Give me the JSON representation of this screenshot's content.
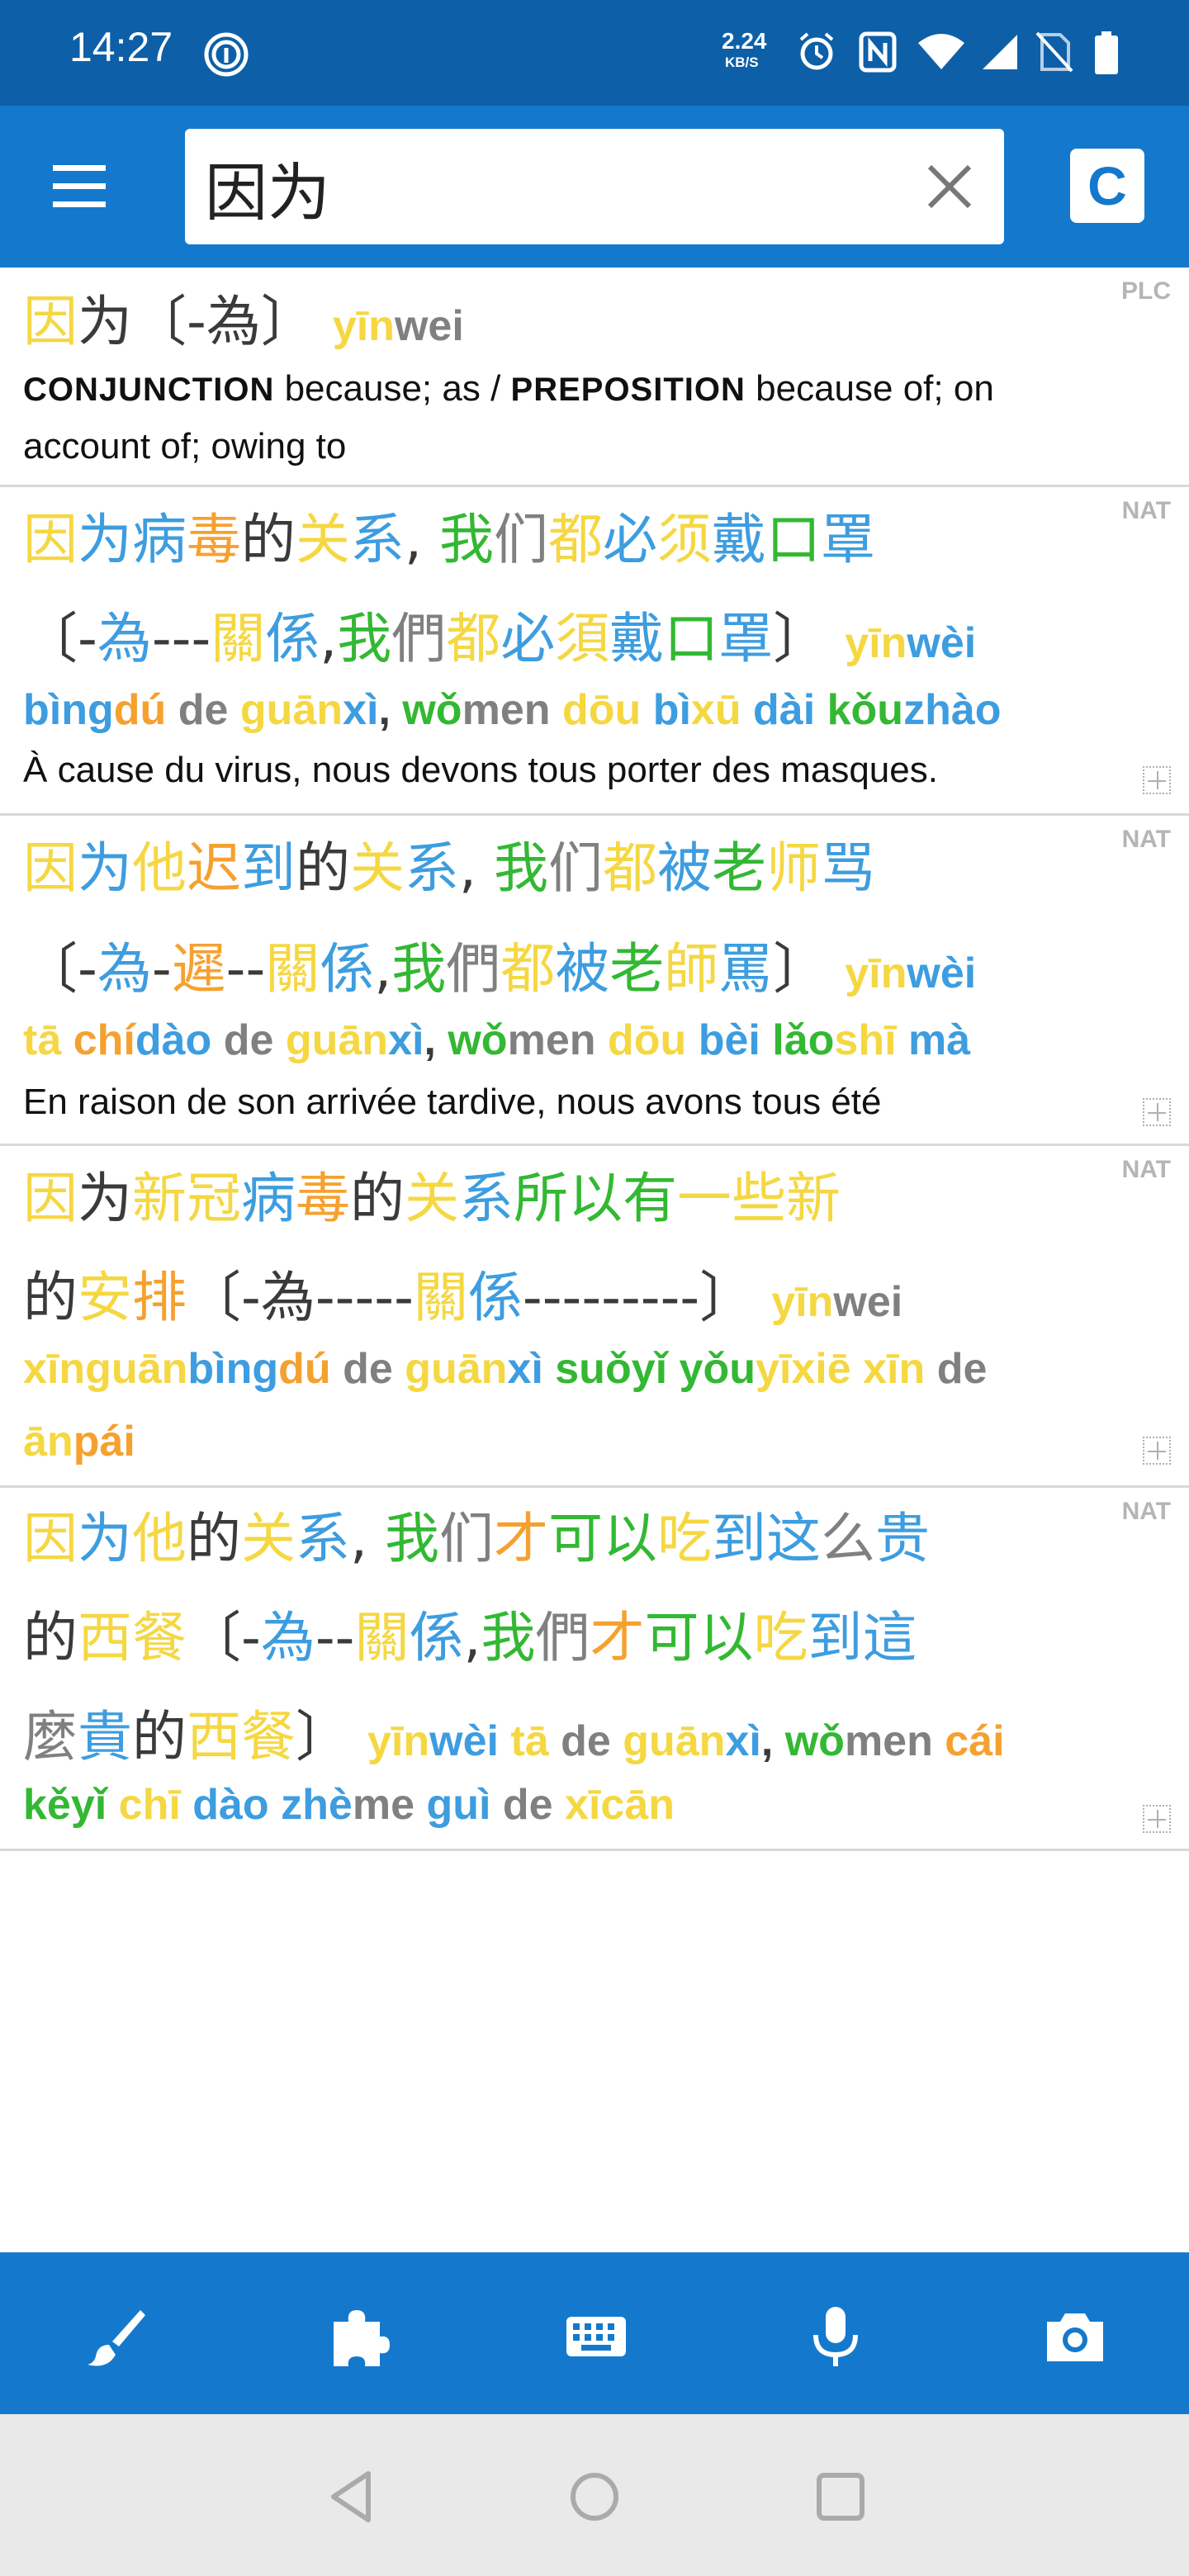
{
  "status_bar": {
    "time": "14:27",
    "net_speed_value": "2.24",
    "net_speed_unit": "KB/S",
    "icons": [
      "fingerprint-icon",
      "alarm-icon",
      "nfc-icon",
      "wifi-icon",
      "signal-icon",
      "no-sim-icon",
      "battery-icon"
    ]
  },
  "search": {
    "value": "因为",
    "clear_icon": "close-icon",
    "menu_icon": "menu-icon",
    "mode_label": "C"
  },
  "colors": {
    "primary": "#1479cc",
    "status_bar": "#0d5fa8",
    "tone1": "#f5d742",
    "tone2": "#f5a130",
    "tone3": "#33b833",
    "tone4": "#3d9de0",
    "tone_neutral": "#808080"
  },
  "entries": [
    {
      "tag": "PLC",
      "lines": [
        [
          [
            "因",
            "t1"
          ],
          [
            "为",
            "t0"
          ],
          [
            "〔-",
            "t0"
          ],
          [
            "為",
            "t0"
          ],
          [
            "〕",
            "t0"
          ],
          [
            " ",
            "t0"
          ],
          [
            "yīn",
            "t1",
            "py"
          ],
          [
            "wei",
            "t5",
            "py"
          ]
        ],
        [
          [
            "CONJUNCTION",
            "pos"
          ],
          [
            " because; as / ",
            "gloss"
          ],
          [
            " PREPOSITION",
            "pos"
          ],
          [
            " because of; on",
            "gloss"
          ]
        ],
        [
          [
            "account of; owing to",
            "gloss"
          ]
        ]
      ]
    },
    {
      "tag": "NAT",
      "lines": [
        [
          [
            "因",
            "t1"
          ],
          [
            "为",
            "t4"
          ],
          [
            "病",
            "t4"
          ],
          [
            "毒",
            "t2"
          ],
          [
            "的",
            "t0"
          ],
          [
            "关",
            "t1"
          ],
          [
            "系",
            "t4"
          ],
          [
            ", ",
            "t0"
          ],
          [
            "我",
            "t3"
          ],
          [
            "们",
            "t5"
          ],
          [
            "都",
            "t1"
          ],
          [
            "必",
            "t4"
          ],
          [
            "须",
            "t1"
          ],
          [
            "戴",
            "t4"
          ],
          [
            "口",
            "t3"
          ],
          [
            "罩",
            "t4"
          ]
        ],
        [
          [
            "〔-",
            "t0"
          ],
          [
            "為",
            "t4"
          ],
          [
            "---",
            "t0"
          ],
          [
            "關",
            "t1"
          ],
          [
            "係",
            "t4"
          ],
          [
            ",",
            "t0"
          ],
          [
            "我",
            "t3"
          ],
          [
            "們",
            "t5"
          ],
          [
            "都",
            "t1"
          ],
          [
            "必",
            "t4"
          ],
          [
            "須",
            "t1"
          ],
          [
            "戴",
            "t4"
          ],
          [
            "口",
            "t3"
          ],
          [
            "罩",
            "t4"
          ],
          [
            "〕",
            "t0"
          ],
          [
            " ",
            "t0"
          ],
          [
            "yīn",
            "t1",
            "py"
          ],
          [
            "wèi",
            "t4",
            "py"
          ]
        ],
        [
          [
            "bìng",
            "t4",
            "py"
          ],
          [
            "dú",
            "t2",
            "py"
          ],
          [
            " de ",
            "t5",
            "py"
          ],
          [
            "guān",
            "t1",
            "py"
          ],
          [
            "xì",
            "t4",
            "py"
          ],
          [
            ", ",
            "t0",
            "py"
          ],
          [
            "wǒ",
            "t3",
            "py"
          ],
          [
            "men",
            "t5",
            "py"
          ],
          [
            " dōu ",
            "t1",
            "py"
          ],
          [
            "bì",
            "t4",
            "py"
          ],
          [
            "xū",
            "t1",
            "py"
          ],
          [
            " dài ",
            "t4",
            "py"
          ],
          [
            "kǒu",
            "t3",
            "py"
          ],
          [
            "zhào",
            "t4",
            "py"
          ]
        ],
        [
          [
            "À cause du virus, nous devons tous porter des masques.",
            "gloss"
          ]
        ]
      ]
    },
    {
      "tag": "NAT",
      "lines": [
        [
          [
            "因",
            "t1"
          ],
          [
            "为",
            "t4"
          ],
          [
            "他",
            "t1"
          ],
          [
            "迟",
            "t2"
          ],
          [
            "到",
            "t4"
          ],
          [
            "的",
            "t0"
          ],
          [
            "关",
            "t1"
          ],
          [
            "系",
            "t4"
          ],
          [
            ", ",
            "t0"
          ],
          [
            "我",
            "t3"
          ],
          [
            "们",
            "t5"
          ],
          [
            "都",
            "t1"
          ],
          [
            "被",
            "t4"
          ],
          [
            "老",
            "t3"
          ],
          [
            "师",
            "t1"
          ],
          [
            "骂",
            "t4"
          ]
        ],
        [
          [
            "〔-",
            "t0"
          ],
          [
            "為",
            "t4"
          ],
          [
            "-",
            "t0"
          ],
          [
            "遲",
            "t2"
          ],
          [
            "--",
            "t0"
          ],
          [
            "關",
            "t1"
          ],
          [
            "係",
            "t4"
          ],
          [
            ",",
            "t0"
          ],
          [
            "我",
            "t3"
          ],
          [
            "們",
            "t5"
          ],
          [
            "都",
            "t1"
          ],
          [
            "被",
            "t4"
          ],
          [
            "老",
            "t3"
          ],
          [
            "師",
            "t1"
          ],
          [
            "罵",
            "t4"
          ],
          [
            "〕",
            "t0"
          ],
          [
            " ",
            "t0"
          ],
          [
            "yīn",
            "t1",
            "py"
          ],
          [
            "wèi",
            "t4",
            "py"
          ]
        ],
        [
          [
            "tā ",
            "t1",
            "py"
          ],
          [
            "chí",
            "t2",
            "py"
          ],
          [
            "dào",
            "t4",
            "py"
          ],
          [
            " de ",
            "t5",
            "py"
          ],
          [
            "guān",
            "t1",
            "py"
          ],
          [
            "xì",
            "t4",
            "py"
          ],
          [
            ", ",
            "t0",
            "py"
          ],
          [
            "wǒ",
            "t3",
            "py"
          ],
          [
            "men",
            "t5",
            "py"
          ],
          [
            " dōu ",
            "t1",
            "py"
          ],
          [
            "bèi ",
            "t4",
            "py"
          ],
          [
            "lǎo",
            "t3",
            "py"
          ],
          [
            "shī",
            "t1",
            "py"
          ],
          [
            " mà",
            "t4",
            "py"
          ]
        ],
        [
          [
            "En raison de son arrivée tardive, nous avons tous été",
            "gloss"
          ]
        ]
      ]
    },
    {
      "tag": "NAT",
      "lines": [
        [
          [
            "因",
            "t1"
          ],
          [
            "为",
            "t0"
          ],
          [
            "新",
            "t1"
          ],
          [
            "冠",
            "t1"
          ],
          [
            "病",
            "t4"
          ],
          [
            "毒",
            "t2"
          ],
          [
            "的",
            "t0"
          ],
          [
            "关",
            "t1"
          ],
          [
            "系",
            "t4"
          ],
          [
            "所",
            "t3"
          ],
          [
            "以",
            "t3"
          ],
          [
            "有",
            "t3"
          ],
          [
            "一",
            "t1"
          ],
          [
            "些",
            "t1"
          ],
          [
            "新",
            "t1"
          ]
        ],
        [
          [
            "的",
            "t0"
          ],
          [
            "安",
            "t1"
          ],
          [
            "排",
            "t2"
          ],
          [
            "〔-",
            "t0"
          ],
          [
            "為",
            "t0"
          ],
          [
            "-----",
            "t0"
          ],
          [
            "關",
            "t1"
          ],
          [
            "係",
            "t4"
          ],
          [
            "---------",
            "t0"
          ],
          [
            "〕",
            "t0"
          ],
          [
            " ",
            "t0"
          ],
          [
            "yīn",
            "t1",
            "py"
          ],
          [
            "wei",
            "t5",
            "py"
          ]
        ],
        [
          [
            "xīn",
            "t1",
            "py"
          ],
          [
            "guān",
            "t1",
            "py"
          ],
          [
            "bìng",
            "t4",
            "py"
          ],
          [
            "dú",
            "t2",
            "py"
          ],
          [
            " de ",
            "t5",
            "py"
          ],
          [
            "guān",
            "t1",
            "py"
          ],
          [
            "xì",
            "t4",
            "py"
          ],
          [
            " suǒ",
            "t3",
            "py"
          ],
          [
            "yǐ ",
            "t3",
            "py"
          ],
          [
            "yǒu",
            "t3",
            "py"
          ],
          [
            "yī",
            "t1",
            "py"
          ],
          [
            "xiē",
            "t1",
            "py"
          ],
          [
            " xīn",
            "t1",
            "py"
          ],
          [
            " de",
            "t5",
            "py"
          ]
        ],
        [
          [
            "ān",
            "t1",
            "py"
          ],
          [
            "pái",
            "t2",
            "py"
          ]
        ]
      ]
    },
    {
      "tag": "NAT",
      "lines": [
        [
          [
            "因",
            "t1"
          ],
          [
            "为",
            "t4"
          ],
          [
            "他",
            "t1"
          ],
          [
            "的",
            "t0"
          ],
          [
            "关",
            "t1"
          ],
          [
            "系",
            "t4"
          ],
          [
            ", ",
            "t0"
          ],
          [
            "我",
            "t3"
          ],
          [
            "们",
            "t5"
          ],
          [
            "才",
            "t2"
          ],
          [
            "可",
            "t3"
          ],
          [
            "以",
            "t3"
          ],
          [
            "吃",
            "t1"
          ],
          [
            "到",
            "t4"
          ],
          [
            "这",
            "t4"
          ],
          [
            "么",
            "t5"
          ],
          [
            "贵",
            "t4"
          ]
        ],
        [
          [
            "的",
            "t0"
          ],
          [
            "西",
            "t1"
          ],
          [
            "餐",
            "t1"
          ],
          [
            "〔-",
            "t0"
          ],
          [
            "為",
            "t4"
          ],
          [
            "--",
            "t0"
          ],
          [
            "關",
            "t1"
          ],
          [
            "係",
            "t4"
          ],
          [
            ",",
            "t0"
          ],
          [
            "我",
            "t3"
          ],
          [
            "們",
            "t5"
          ],
          [
            "才",
            "t2"
          ],
          [
            "可",
            "t3"
          ],
          [
            "以",
            "t3"
          ],
          [
            "吃",
            "t1"
          ],
          [
            "到",
            "t4"
          ],
          [
            "這",
            "t4"
          ]
        ],
        [
          [
            "麼",
            "t5"
          ],
          [
            "貴",
            "t4"
          ],
          [
            "的",
            "t0"
          ],
          [
            "西",
            "t1"
          ],
          [
            "餐",
            "t1"
          ],
          [
            "〕",
            "t0"
          ],
          [
            " ",
            "t0"
          ],
          [
            "yīn",
            "t1",
            "py"
          ],
          [
            "wèi",
            "t4",
            "py"
          ],
          [
            " tā",
            "t1",
            "py"
          ],
          [
            " de ",
            "t5",
            "py"
          ],
          [
            "guān",
            "t1",
            "py"
          ],
          [
            "xì",
            "t4",
            "py"
          ],
          [
            ", ",
            "t0",
            "py"
          ],
          [
            "wǒ",
            "t3",
            "py"
          ],
          [
            "men",
            "t5",
            "py"
          ],
          [
            " cái",
            "t2",
            "py"
          ]
        ],
        [
          [
            "kě",
            "t3",
            "py"
          ],
          [
            "yǐ",
            "t3",
            "py"
          ],
          [
            " chī",
            "t1",
            "py"
          ],
          [
            " dào",
            "t4",
            "py"
          ],
          [
            " zhè",
            "t4",
            "py"
          ],
          [
            "me",
            "t5",
            "py"
          ],
          [
            " guì",
            "t4",
            "py"
          ],
          [
            " de ",
            "t5",
            "py"
          ],
          [
            "xī",
            "t1",
            "py"
          ],
          [
            "cān",
            "t1",
            "py"
          ]
        ]
      ]
    }
  ],
  "toolbar": {
    "tools": [
      "brush-icon",
      "puzzle-icon",
      "keyboard-icon",
      "microphone-icon",
      "camera-icon"
    ]
  },
  "nav": {
    "buttons": [
      "back-icon",
      "home-icon",
      "recents-icon"
    ]
  }
}
